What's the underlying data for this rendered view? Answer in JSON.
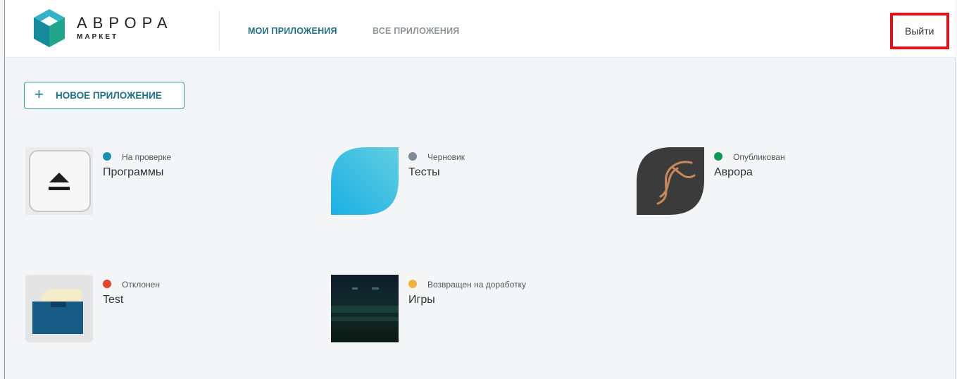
{
  "brand": {
    "name": "АВРОРА",
    "sub": "МАРКЕТ",
    "colors": {
      "top": "#34b3c8",
      "left": "#168a9d",
      "right": "#21a58c"
    }
  },
  "nav": {
    "my_apps": "МОИ ПРИЛОЖЕНИЯ",
    "all_apps": "ВСЕ ПРИЛОЖЕНИЯ"
  },
  "logout_label": "Выйти",
  "new_app_label": "НОВОЕ ПРИЛОЖЕНИЕ",
  "apps": [
    {
      "status": "На проверке",
      "status_color": "#1b8fb0",
      "name": "Программы",
      "icon": "eject-icon"
    },
    {
      "status": "Черновик",
      "status_color": "#7d8a99",
      "name": "Тесты",
      "icon": "leaf-icon"
    },
    {
      "status": "Опубликован",
      "status_color": "#109a58",
      "name": "Аврора",
      "icon": "aurora-leaf-icon"
    },
    {
      "status": "Отклонен",
      "status_color": "#e2442c",
      "name": "Test",
      "icon": "archive-box-icon"
    },
    {
      "status": "Возвращен на доработку",
      "status_color": "#f0b43c",
      "name": "Игры",
      "icon": "game-thumbnail-icon"
    }
  ]
}
